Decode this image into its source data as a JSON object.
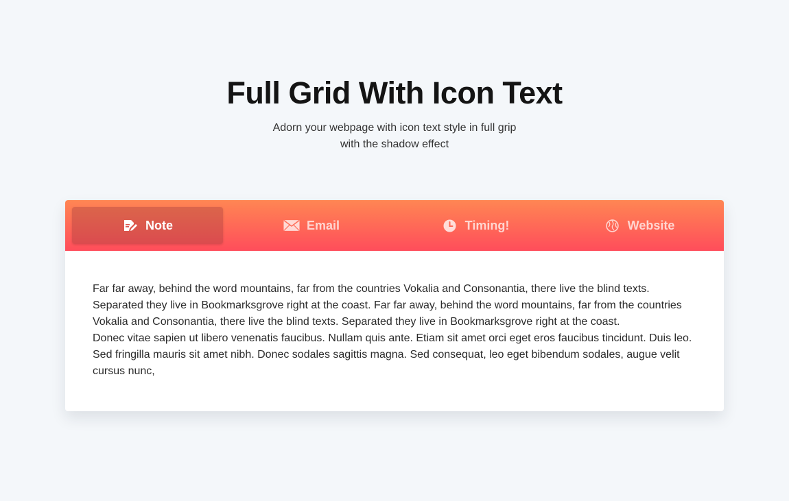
{
  "header": {
    "title": "Full Grid With Icon Text",
    "subtitle": "Adorn your webpage with icon text style in full grip with the shadow effect"
  },
  "tabs": [
    {
      "label": "Note",
      "icon": "note-edit-icon",
      "active": true
    },
    {
      "label": "Email",
      "icon": "envelope-icon",
      "active": false
    },
    {
      "label": "Timing!",
      "icon": "clock-icon",
      "active": false
    },
    {
      "label": "Website",
      "icon": "globe-icon",
      "active": false
    }
  ],
  "content": {
    "paragraph_1": "Far far away, behind the word mountains, far from the countries Vokalia and Consonantia, there live the blind texts. Separated they live in Bookmarksgrove right at the coast. Far far away, behind the word mountains, far from the countries Vokalia and Consonantia, there live the blind texts. Separated they live in Bookmarksgrove right at the coast.",
    "paragraph_2": "Donec vitae sapien ut libero venenatis faucibus. Nullam quis ante. Etiam sit amet orci eget eros faucibus tincidunt. Duis leo. Sed fringilla mauris sit amet nibh. Donec sodales sagittis magna. Sed consequat, leo eget bibendum sodales, augue velit cursus nunc,"
  },
  "colors": {
    "background": "#f4f7fa",
    "tabbar_gradient_top": "#ff8653",
    "tabbar_gradient_bottom": "#ff4d5b",
    "active_tab_bg": "#d9544f",
    "title": "#141414",
    "body_text": "#2b2b2b"
  }
}
